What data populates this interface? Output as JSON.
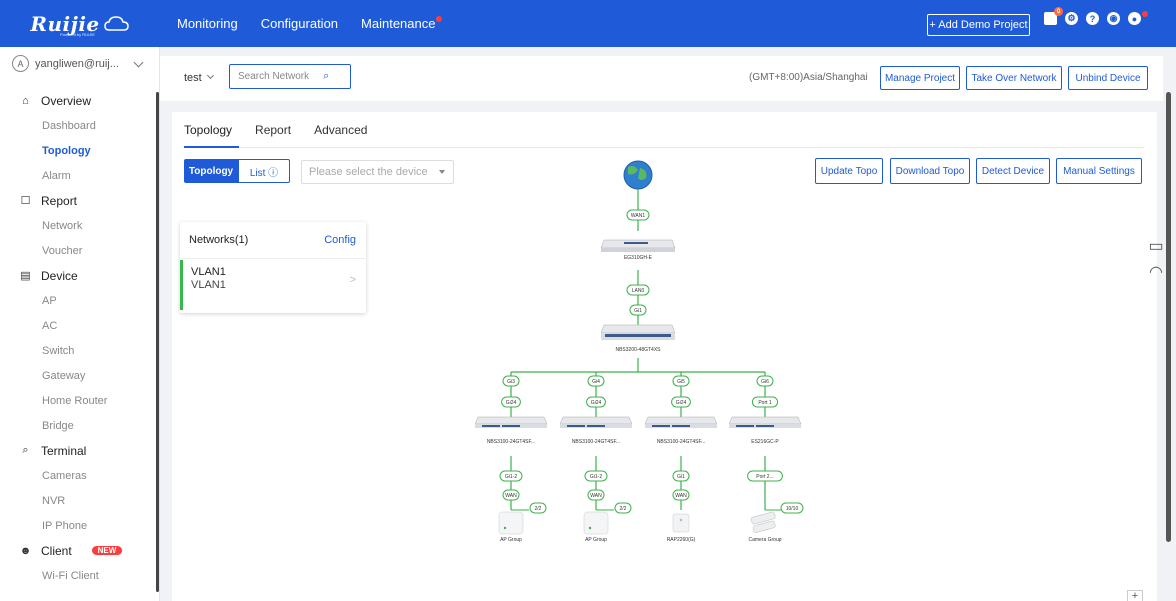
{
  "brand": {
    "logo": "Ruijie",
    "logo_sub": "Powered by RUIJIE"
  },
  "nav": [
    "Monitoring",
    "Configuration",
    "Maintenance"
  ],
  "header_actions": {
    "demo": "+ Add Demo Project",
    "notification_count": "0"
  },
  "user": {
    "name": "yangliwen@ruij..."
  },
  "menu": {
    "overview": "Overview",
    "dashboard": "Dashboard",
    "topology": "Topology",
    "alarm": "Alarm",
    "report": "Report",
    "network": "Network",
    "voucher": "Voucher",
    "device": "Device",
    "ap": "AP",
    "ac": "AC",
    "switch": "Switch",
    "gateway": "Gateway",
    "home_router": "Home Router",
    "bridge": "Bridge",
    "terminal": "Terminal",
    "cameras": "Cameras",
    "nvr": "NVR",
    "ip_phone": "IP Phone",
    "client": "Client",
    "wifi_client": "Wi-Fi Client",
    "new_badge": "NEW"
  },
  "subheader": {
    "project": "test",
    "search_placeholder": "Search Network",
    "timezone": "(GMT+8:00)Asia/Shanghai",
    "manage": "Manage Project",
    "takeover": "Take Over Network",
    "unbind": "Unbind Device"
  },
  "tabs": [
    "Topology",
    "Report",
    "Advanced"
  ],
  "view_toggle": {
    "topology": "Topology",
    "list": "List ⓘ"
  },
  "device_select_placeholder": "Please select the device",
  "actions": {
    "update": "Update Topo",
    "download": "Download Topo",
    "detect": "Detect Device",
    "manual": "Manual Settings"
  },
  "networks": {
    "title": "Networks(1)",
    "config": "Config",
    "row_l1": "VLAN1",
    "row_l2": "VLAN1"
  },
  "topology": {
    "wan": "WAN1",
    "gateway": "EG310GH-E",
    "lan": "LAN0",
    "gi1": "Gi1",
    "core": "NBS3200-48GT4XS",
    "branches": [
      {
        "up": "Gi3",
        "down": "Gi24",
        "name": "NBS3100-24GT4SF...",
        "port": "Gi1-2",
        "wan": "WAN",
        "count": "2/2",
        "leaf": "AP Group"
      },
      {
        "up": "Gi4",
        "down": "Gi24",
        "name": "NBS3100-24GT4SF...",
        "port": "Gi1-2",
        "wan": "WAN",
        "count": "2/2",
        "leaf": "AP Group"
      },
      {
        "up": "Gi5",
        "down": "Gi24",
        "name": "NBS3100-24GT4SF...",
        "port": "Gi1",
        "wan": "WAN",
        "count": "",
        "leaf": "RAP2260(G)"
      },
      {
        "up": "Gi6",
        "down": "Port 1",
        "name": "ES216GC-P",
        "port": "Port 2...",
        "wan": "",
        "count": "10/10",
        "leaf": "Camera Group"
      }
    ]
  },
  "colors": {
    "primary": "#1f5bd8",
    "link": "#3cb14a"
  }
}
